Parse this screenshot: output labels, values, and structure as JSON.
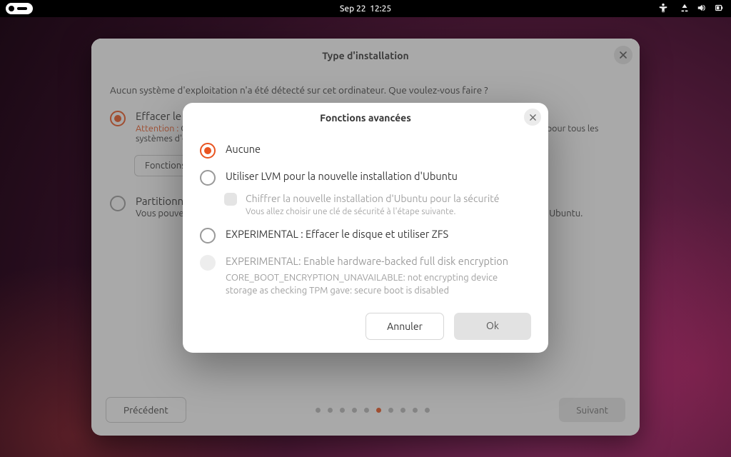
{
  "topbar": {
    "date": "Sep 22",
    "time": "12:25"
  },
  "window": {
    "title": "Type d'installation",
    "prompt": "Aucun système d'exploitation n'a été détecté sur cet ordinateur. Que voulez-vous faire ?",
    "erase": {
      "title": "Effacer le disque et installer Ubuntu",
      "warn_label": "Attention :",
      "warn_text": "Cela va supprimer tous vos programmes, documents, photos, musiques et tout autre fichier pour tous les systèmes d'exploitation."
    },
    "adv_button": "Fonctions avancées...",
    "partition": {
      "title": "Partitionnement manuel",
      "hint": "Vous pouvez créer ou redimensionner les partitions vous-même, ou choisir plusieurs partitions pour Ubuntu."
    },
    "prev": "Précédent",
    "next": "Suivant",
    "dots_total": 10,
    "dots_active_index": 5
  },
  "modal": {
    "title": "Fonctions avancées",
    "opt_none": "Aucune",
    "opt_lvm": "Utiliser LVM pour la nouvelle installation d'Ubuntu",
    "opt_encrypt_title": "Chiffrer la nouvelle installation d'Ubuntu pour la sécurité",
    "opt_encrypt_hint": "Vous allez choisir une clé de sécurité à l'étape suivante.",
    "opt_zfs": "EXPERIMENTAL : Effacer le disque et utiliser ZFS",
    "opt_hw_title": "EXPERIMENTAL: Enable hardware-backed full disk encryption",
    "opt_hw_desc": "CORE_BOOT_ENCRYPTION_UNAVAILABLE: not encrypting device storage as checking TPM gave: secure boot is disabled",
    "cancel": "Annuler",
    "ok": "Ok"
  }
}
